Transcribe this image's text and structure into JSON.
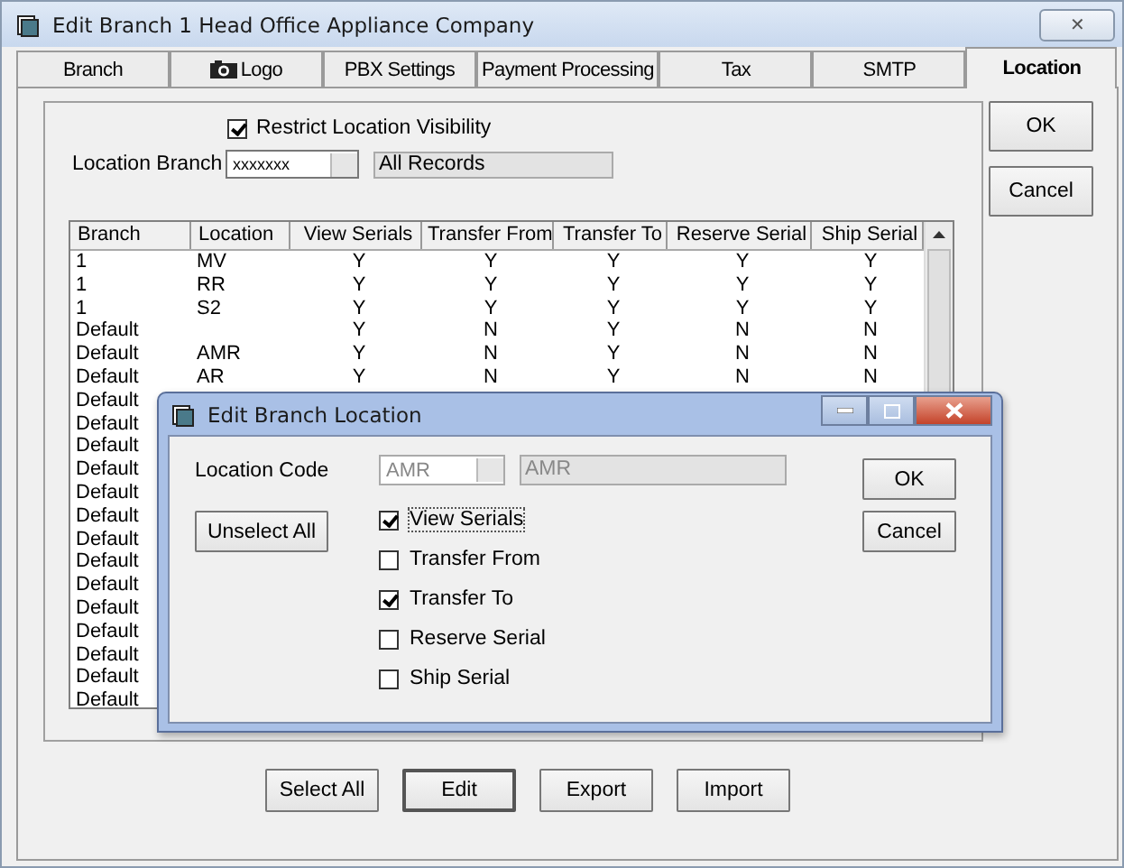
{
  "window": {
    "title": "Edit Branch 1 Head Office Appliance Company",
    "close": "✕"
  },
  "tabs": [
    {
      "label": "Branch",
      "selected": false,
      "has_icon": false
    },
    {
      "label": "Logo",
      "selected": false,
      "has_icon": true
    },
    {
      "label": "PBX Settings",
      "selected": false,
      "has_icon": false
    },
    {
      "label": "Payment Processing",
      "selected": false,
      "has_icon": false
    },
    {
      "label": "Tax",
      "selected": false,
      "has_icon": false
    },
    {
      "label": "SMTP",
      "selected": false,
      "has_icon": false
    },
    {
      "label": "Location",
      "selected": true,
      "has_icon": false
    }
  ],
  "restrict": {
    "label": "Restrict Location Visibility",
    "checked": true
  },
  "location_branch": {
    "label": "Location Branch",
    "value": "xxxxxxx",
    "description": "All Records"
  },
  "table": {
    "columns": [
      "Branch",
      "Location",
      "View Serials",
      "Transfer From",
      "Transfer To",
      "Reserve Serial",
      "Ship Serial"
    ],
    "rows": [
      [
        "1",
        "MV",
        "Y",
        "Y",
        "Y",
        "Y",
        "Y"
      ],
      [
        "1",
        "RR",
        "Y",
        "Y",
        "Y",
        "Y",
        "Y"
      ],
      [
        "1",
        "S2",
        "Y",
        "Y",
        "Y",
        "Y",
        "Y"
      ],
      [
        "Default",
        "",
        "Y",
        "N",
        "Y",
        "N",
        "N"
      ],
      [
        "Default",
        "AMR",
        "Y",
        "N",
        "Y",
        "N",
        "N"
      ],
      [
        "Default",
        "AR",
        "Y",
        "N",
        "Y",
        "N",
        "N"
      ],
      [
        "Default"
      ],
      [
        "Default"
      ],
      [
        "Default"
      ],
      [
        "Default"
      ],
      [
        "Default"
      ],
      [
        "Default"
      ],
      [
        "Default"
      ],
      [
        "Default"
      ],
      [
        "Default"
      ],
      [
        "Default"
      ],
      [
        "Default"
      ],
      [
        "Default"
      ],
      [
        "Default"
      ],
      [
        "Default"
      ]
    ]
  },
  "actions": [
    {
      "label": "Select All",
      "default": false
    },
    {
      "label": "Edit",
      "default": true
    },
    {
      "label": "Export",
      "default": false
    },
    {
      "label": "Import",
      "default": false
    }
  ],
  "side_buttons": [
    "OK",
    "Cancel"
  ],
  "dialog": {
    "title": "Edit Branch Location",
    "location_code": {
      "label": "Location Code",
      "value": "AMR",
      "description": "AMR"
    },
    "unselect": "Unselect All",
    "options": [
      {
        "label": "View Serials",
        "checked": true,
        "focused": true
      },
      {
        "label": "Transfer From",
        "checked": false,
        "focused": false
      },
      {
        "label": "Transfer To",
        "checked": true,
        "focused": false
      },
      {
        "label": "Reserve Serial",
        "checked": false,
        "focused": false
      },
      {
        "label": "Ship Serial",
        "checked": false,
        "focused": false
      }
    ],
    "buttons": [
      "OK",
      "Cancel"
    ]
  }
}
